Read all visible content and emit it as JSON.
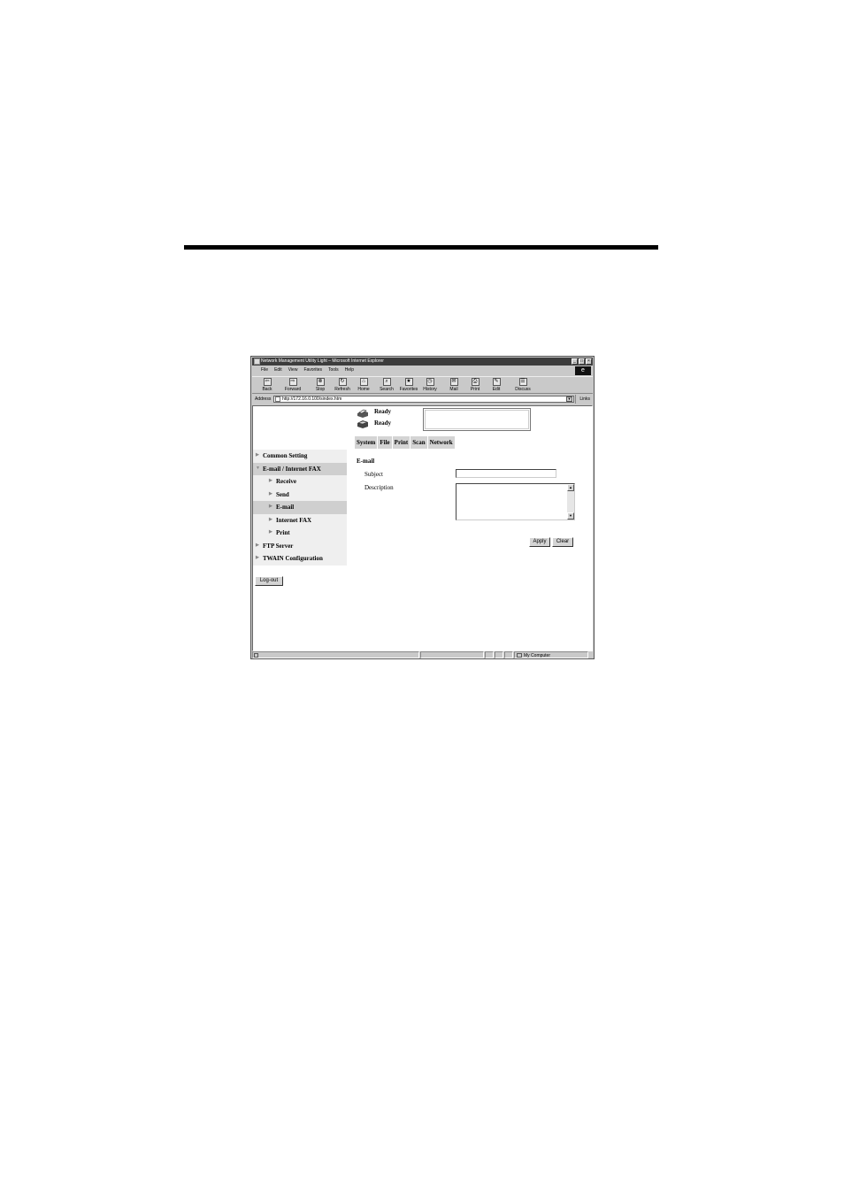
{
  "window": {
    "title": "Network Management Utility Light – Microsoft Internet Explorer",
    "controls": [
      "_",
      "□",
      "×"
    ]
  },
  "menu": [
    "File",
    "Edit",
    "View",
    "Favorites",
    "Tools",
    "Help"
  ],
  "toolbar": [
    {
      "label": "Back",
      "icon": "back-icon",
      "glyph": "⇦"
    },
    {
      "label": "Forward",
      "icon": "forward-icon",
      "glyph": "⇨"
    },
    {
      "label": "Stop",
      "icon": "stop-icon",
      "glyph": "⊗"
    },
    {
      "label": "Refresh",
      "icon": "refresh-icon",
      "glyph": "↻"
    },
    {
      "label": "Home",
      "icon": "home-icon",
      "glyph": "⌂"
    },
    {
      "label": "Search",
      "icon": "search-icon",
      "glyph": "⌕"
    },
    {
      "label": "Favorites",
      "icon": "favorites-icon",
      "glyph": "★"
    },
    {
      "label": "History",
      "icon": "history-icon",
      "glyph": "◷"
    },
    {
      "label": "Mail",
      "icon": "mail-icon",
      "glyph": "✉"
    },
    {
      "label": "Print",
      "icon": "print-icon",
      "glyph": "⎙"
    },
    {
      "label": "Edit",
      "icon": "edit-icon",
      "glyph": "✎"
    },
    {
      "label": "Discuss",
      "icon": "discuss-icon",
      "glyph": "☰"
    }
  ],
  "address": {
    "label": "Address",
    "url": "http://172.16.0.100/sindex.htm",
    "links": "Links"
  },
  "status": {
    "line1": "Ready",
    "line2": "Ready"
  },
  "sidebar": {
    "items": [
      {
        "label": "Common Setting"
      },
      {
        "label": "E-mail / Internet FAX"
      },
      {
        "label": "Receive"
      },
      {
        "label": "Send"
      },
      {
        "label": "E-mail"
      },
      {
        "label": "Internet FAX"
      },
      {
        "label": "Print"
      },
      {
        "label": "FTP Server"
      },
      {
        "label": "TWAIN Configuration"
      }
    ],
    "logout": "Log-out"
  },
  "tabs": [
    "System",
    "File",
    "Print",
    "Scan",
    "Network"
  ],
  "form": {
    "section": "E-mail",
    "subject_label": "Subject",
    "subject_value": "",
    "description_label": "Description",
    "description_value": "",
    "apply": "Apply",
    "clear": "Clear"
  },
  "statusbar": {
    "zone": "My Computer"
  }
}
